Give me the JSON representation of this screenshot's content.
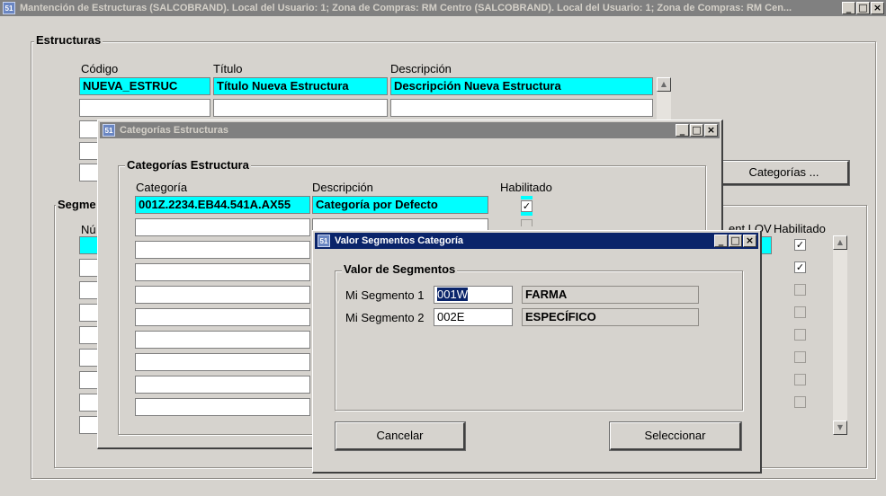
{
  "main_window": {
    "title": "Mantención de Estructuras (SALCOBRAND). Local del Usuario: 1; Zona de Compras: RM Centro (SALCOBRAND). Local del Usuario: 1; Zona de Compras: RM Cen...",
    "icon_text": "51"
  },
  "estructuras": {
    "group_label": "Estructuras",
    "col_codigo": "Código",
    "col_titulo": "Título",
    "col_descripcion": "Descripción",
    "rows": [
      {
        "codigo": "NUEVA_ESTRUC",
        "titulo": "Título Nueva Estructura",
        "descripcion": "Descripción Nueva Estructura"
      },
      {
        "codigo": "",
        "titulo": "",
        "descripcion": ""
      },
      {
        "codigo": "",
        "titulo": "",
        "descripcion": ""
      },
      {
        "codigo": "",
        "titulo": "",
        "descripcion": ""
      },
      {
        "codigo": "",
        "titulo": "",
        "descripcion": ""
      }
    ],
    "categorias_button": "Categorías ..."
  },
  "segmentos": {
    "group_label": "Segme",
    "col_numero": "Nú",
    "col_lov": "ent LOV",
    "col_habilitado": "Habilitado",
    "habilitado": [
      true,
      true,
      false,
      false,
      false,
      false,
      false,
      false
    ]
  },
  "categorias_window": {
    "title": "Categorías Estructuras",
    "group_label": "Categorías Estructura",
    "col_categoria": "Categoría",
    "col_descripcion": "Descripción",
    "col_habilitado": "Habilitado",
    "rows": [
      {
        "categoria": "001Z.2234.EB44.541A.AX55",
        "descripcion": "Categoría por Defecto",
        "habilitado": true
      },
      {
        "categoria": "",
        "descripcion": ""
      },
      {
        "categoria": "",
        "descripcion": ""
      },
      {
        "categoria": "",
        "descripcion": ""
      },
      {
        "categoria": "",
        "descripcion": ""
      },
      {
        "categoria": "",
        "descripcion": ""
      },
      {
        "categoria": "",
        "descripcion": ""
      },
      {
        "categoria": "",
        "descripcion": ""
      },
      {
        "categoria": "",
        "descripcion": ""
      },
      {
        "categoria": "",
        "descripcion": ""
      }
    ]
  },
  "valor_window": {
    "title": "Valor Segmentos Categoría",
    "group_label": "Valor de Segmentos",
    "rows": [
      {
        "label": "Mi Segmento 1",
        "code": "001W",
        "value": "FARMA"
      },
      {
        "label": "Mi Segmento 2",
        "code": "002E",
        "value": "ESPECÍFICO"
      }
    ],
    "cancel_button": "Cancelar",
    "select_button": "Seleccionar"
  },
  "window_buttons": {
    "minimize": "_",
    "maximize": "□",
    "close": "×"
  },
  "check_mark": "✓",
  "scroll_up": "▲",
  "scroll_down": "▼"
}
